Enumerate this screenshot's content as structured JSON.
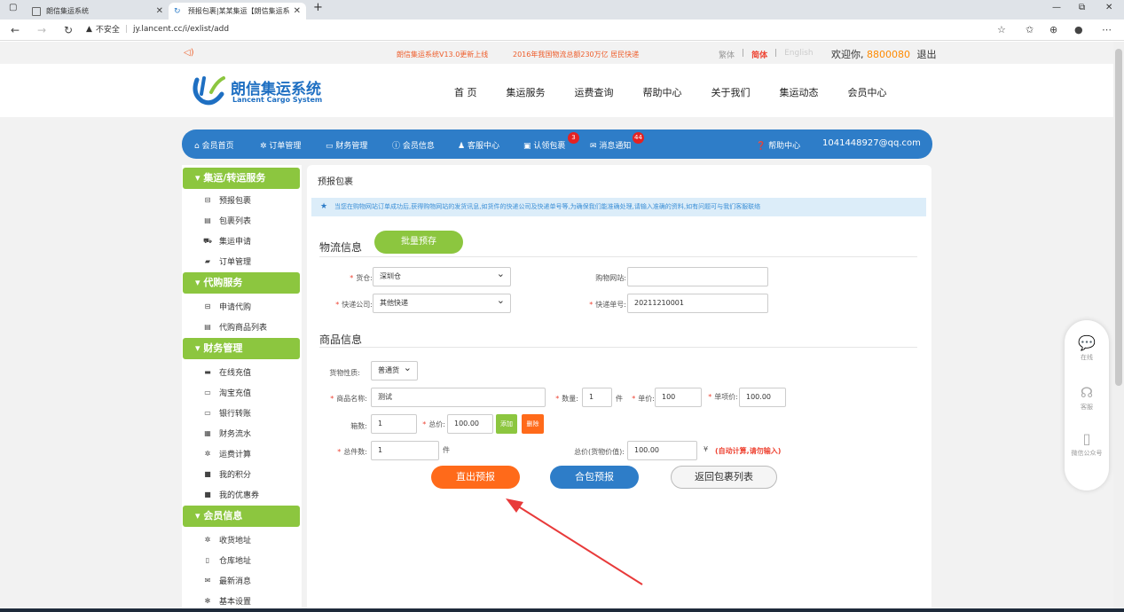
{
  "browser": {
    "tabs": [
      {
        "title": "朗信集运系统"
      },
      {
        "title": "预报包裹|某某集运【朗信集运系"
      }
    ],
    "security_label": "不安全",
    "url": "jy.lancent.cc/i/exlist/add"
  },
  "topstrip": {
    "news": [
      "朗信集运系统V13.0更新上线",
      "2016年我国物流总额230万亿 居民快递"
    ],
    "languages": [
      "繁体",
      "简体",
      "English"
    ],
    "welcome_label": "欢迎你,",
    "user_id": "8800080",
    "logout": "退出"
  },
  "header": {
    "logo_cn": "朗信集运系统",
    "logo_en": "Lancent Cargo System",
    "nav": [
      "首 页",
      "集运服务",
      "运费查询",
      "帮助中心",
      "关于我们",
      "集运动态",
      "会员中心"
    ]
  },
  "member_nav": {
    "items": [
      {
        "label": "会员首页",
        "icon": "home-icon"
      },
      {
        "label": "订单管理",
        "icon": "gear-icon"
      },
      {
        "label": "财务管理",
        "icon": "wallet-icon"
      },
      {
        "label": "会员信息",
        "icon": "info-icon"
      },
      {
        "label": "客服中心",
        "icon": "user-icon"
      },
      {
        "label": "认领包裹",
        "icon": "box-icon",
        "badge": "3"
      },
      {
        "label": "消息通知",
        "icon": "mail-icon",
        "badge": "44"
      }
    ],
    "help": "帮助中心",
    "email": "1041448927@qq.com"
  },
  "sidebar": {
    "groups": [
      {
        "title": "集运/转运服务",
        "items": [
          "预报包裹",
          "包裹列表",
          "集运申请",
          "订单管理"
        ]
      },
      {
        "title": "代购服务",
        "items": [
          "申请代购",
          "代购商品列表"
        ]
      },
      {
        "title": "财务管理",
        "items": [
          "在线充值",
          "淘宝充值",
          "银行转账",
          "财务流水",
          "运费计算",
          "我的积分",
          "我的优惠券"
        ]
      },
      {
        "title": "会员信息",
        "items": [
          "收货地址",
          "仓库地址",
          "最新消息",
          "基本设置"
        ]
      }
    ]
  },
  "main": {
    "title": "预报包裹",
    "notice": "当您在购物网站订单成功后,获得购物网站的发货讯息,如货件的快递公司及快递单号等,为确保我们能准确处理,请输入准确的资料,如有问题可与我们客服联络",
    "logistics": {
      "section_title": "物流信息",
      "batch_button": "批量预存",
      "warehouse_label": "货仓:",
      "warehouse_value": "深圳仓",
      "shop_site_label": "购物网站:",
      "shop_site_value": "",
      "courier_label": "快递公司:",
      "courier_value": "其他快递",
      "tracking_label": "快递单号:",
      "tracking_value": "20211210001"
    },
    "goods": {
      "section_title": "商品信息",
      "nature_label": "货物性质:",
      "nature_value": "普通货",
      "name_label": "商品名称:",
      "name_value": "测试",
      "qty_label": "数量:",
      "qty_value": "1",
      "qty_unit": "件",
      "price_label": "单价:",
      "price_value": "100",
      "single_total_label": "单项价:",
      "single_total_value": "100.00",
      "boxes_label": "箱数:",
      "boxes_value": "1",
      "total_label": "总价:",
      "total_value": "100.00",
      "add_btn": "添加",
      "del_btn": "删除",
      "count_label": "总件数:",
      "count_value": "1",
      "count_unit": "件",
      "declared_label": "总价(货物价值):",
      "declared_value": "100.00",
      "currency": "¥",
      "auto_hint": "(自动计算,请勿输入)"
    },
    "buttons": {
      "submit": "直出预报",
      "combine": "合包预报",
      "back": "返回包裹列表"
    }
  },
  "float_widget": [
    "在线",
    "客服",
    "微信公众号"
  ],
  "colors": {
    "brand_blue": "#2e7dc8",
    "green": "#8cc63f",
    "orange": "#ff6a1a",
    "red_accent": "#e43333"
  }
}
